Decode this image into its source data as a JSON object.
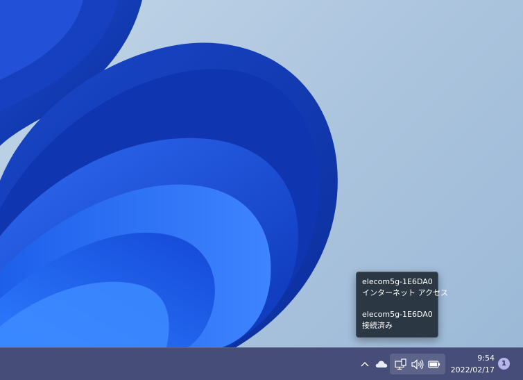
{
  "tooltip": {
    "network_name_1": "elecom5g-1E6DA0",
    "status_1": "インターネット アクセス",
    "network_name_2": "elecom5g-1E6DA0",
    "status_2": "接続済み"
  },
  "taskbar": {
    "time": "9:54",
    "date": "2022/02/17",
    "notification_count": "1",
    "tray_icons": [
      "chevron-up-icon",
      "onedrive-cloud-icon",
      "network-icon",
      "volume-icon",
      "battery-icon"
    ]
  },
  "colors": {
    "taskbar": "#454d78",
    "tooltip_bg": "#2b3742",
    "badge": "#b7b5ee",
    "wallpaper_bg": "#aec6df",
    "bloom_blue": "#1f4fd0"
  }
}
